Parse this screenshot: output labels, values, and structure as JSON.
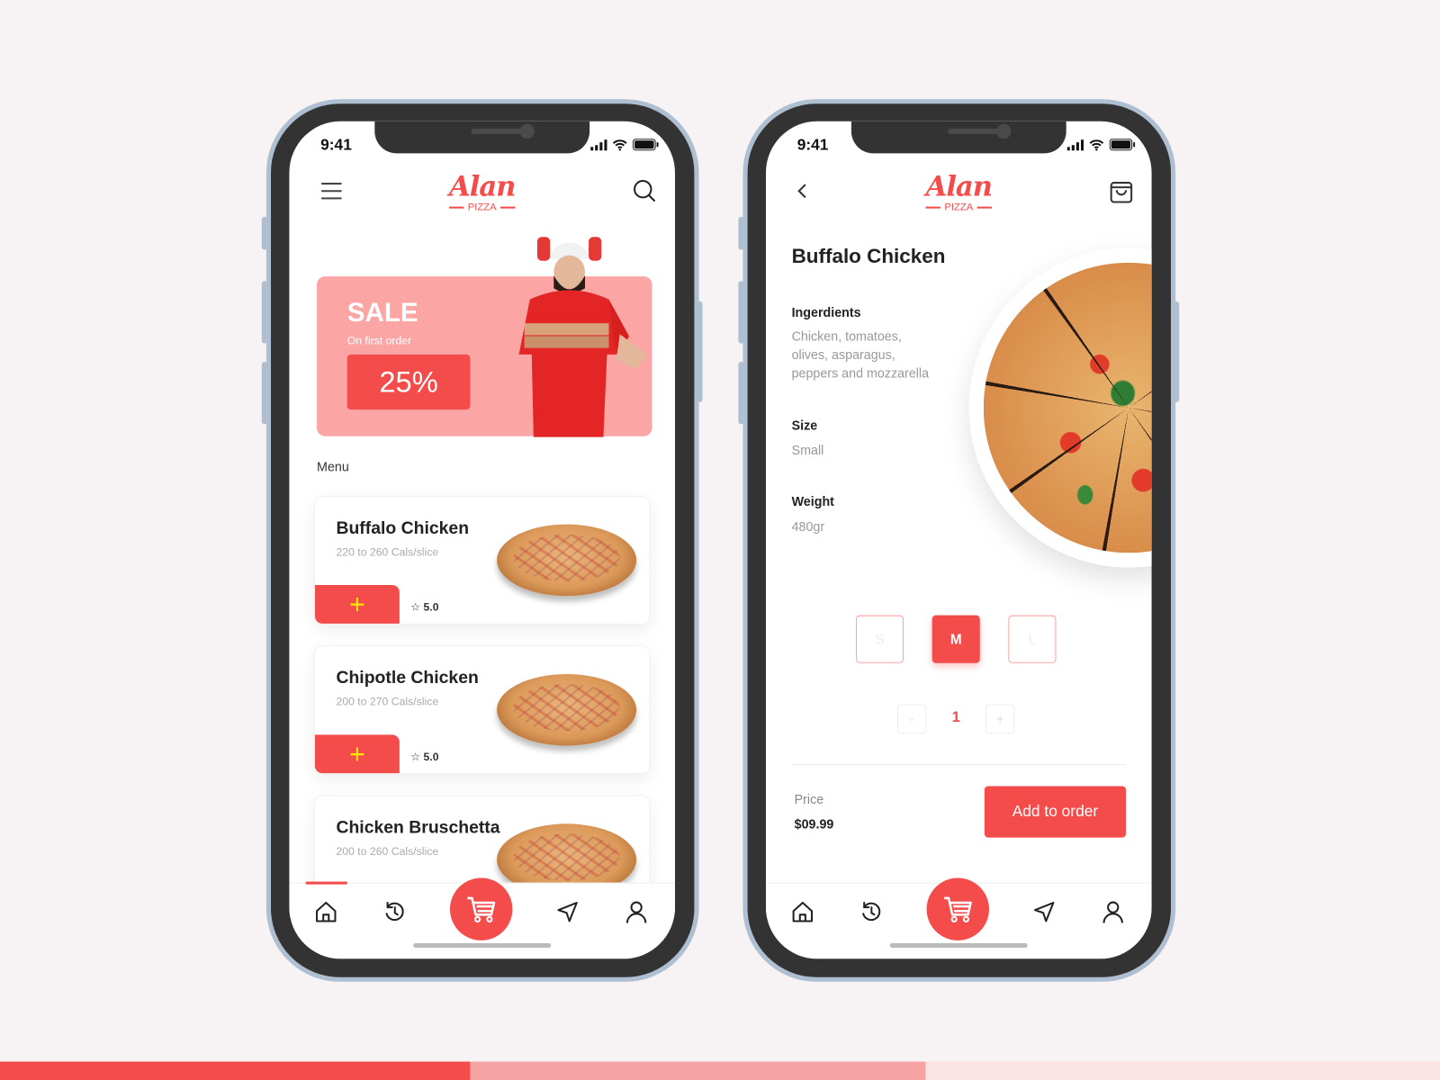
{
  "colors": {
    "accent": "#f44b4b",
    "banner": "#fca5a5",
    "background": "#f7f2f3",
    "plus": "#ffe600"
  },
  "status_bar": {
    "time": "9:41"
  },
  "brand": {
    "logo_script": "Alan",
    "logo_sub": "PIZZA"
  },
  "home": {
    "banner": {
      "title": "SALE",
      "subtitle": "On first order",
      "discount": "25%"
    },
    "menu_label": "Menu",
    "items": [
      {
        "name": "Buffalo Chicken",
        "calories": "220 to 260 Cals/slice",
        "rating": "5.0",
        "add": "+"
      },
      {
        "name": "Chipotle Chicken",
        "calories": "200 to 270 Cals/slice",
        "rating": "5.0",
        "add": "+"
      },
      {
        "name": "Chicken Bruschetta",
        "calories": "200 to 260 Cals/slice"
      }
    ],
    "nav_active": "home"
  },
  "detail": {
    "title": "Buffalo Chicken",
    "ingredients_label": "Ingerdients",
    "ingredients": [
      "Chicken, tomatoes,",
      "olives, asparagus,",
      "peppers and mozzarella"
    ],
    "size_label": "Size",
    "size_value": "Small",
    "weight_label": "Weight",
    "weight_value": "480gr",
    "sizes": [
      "S",
      "M",
      "L"
    ],
    "selected_size": "M",
    "qty_minus": "-",
    "quantity": "1",
    "qty_plus": "+",
    "price_label": "Price",
    "price": "$09.99",
    "add_button": "Add to order"
  },
  "nav_icons": [
    "home-icon",
    "history-icon",
    "cart-icon",
    "send-icon",
    "user-icon"
  ]
}
